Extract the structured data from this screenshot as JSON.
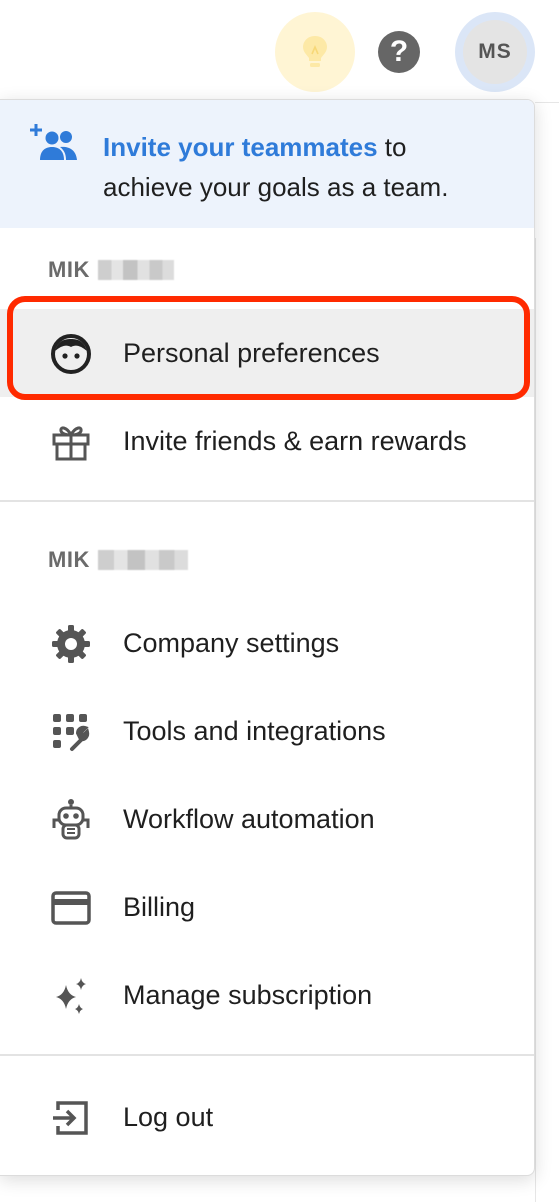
{
  "header": {
    "tips_icon": "lightbulb-icon",
    "help_icon": "question-mark-icon",
    "help_glyph": "?",
    "avatar_initials": "MS"
  },
  "menu": {
    "invite_banner": {
      "icon": "add-people-icon",
      "link_text": "Invite your teammates",
      "rest_text": " to achieve your goals as a team."
    },
    "personal_section": {
      "label": "MIK",
      "items": [
        {
          "label": "Personal preferences",
          "icon": "face-icon"
        },
        {
          "label": "Invite friends & earn rewards",
          "icon": "gift-icon"
        }
      ]
    },
    "company_section": {
      "label": "MIK",
      "items": [
        {
          "label": "Company settings",
          "icon": "gear-icon"
        },
        {
          "label": "Tools and integrations",
          "icon": "tools-integrations-icon"
        },
        {
          "label": "Workflow automation",
          "icon": "robot-icon"
        },
        {
          "label": "Billing",
          "icon": "credit-card-icon"
        },
        {
          "label": "Manage subscription",
          "icon": "sparkles-icon"
        }
      ]
    },
    "logout": {
      "label": "Log out",
      "icon": "logout-icon"
    }
  },
  "colors": {
    "accent_link": "#2f7bd9",
    "highlight_ring": "#ff2a00",
    "banner_bg": "#edf3fc",
    "icon_grey": "#555555"
  }
}
